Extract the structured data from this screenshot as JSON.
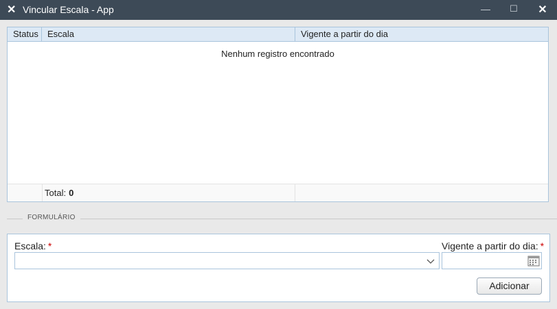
{
  "window": {
    "title": "Vincular Escala - App",
    "icon": "close-x-icon",
    "controls": {
      "minimize": "—",
      "maximize": "☐",
      "close": "✕"
    }
  },
  "grid": {
    "columns": [
      "Status",
      "Escala",
      "Vigente a partir do dia"
    ],
    "empty_message": "Nenhum registro encontrado",
    "footer": {
      "total_label": "Total:",
      "total_value": "0"
    }
  },
  "form": {
    "legend": "FORMULÁRIO",
    "escala_label": "Escala:",
    "vigente_label": "Vigente a partir do dia:",
    "required_mark": "*",
    "escala_value": "",
    "vigente_value": "",
    "add_button": "Adicionar"
  },
  "colors": {
    "titlebar": "#3d4a57",
    "grid_header": "#dde9f5",
    "border": "#a9c4dc",
    "required": "#cc0000"
  }
}
